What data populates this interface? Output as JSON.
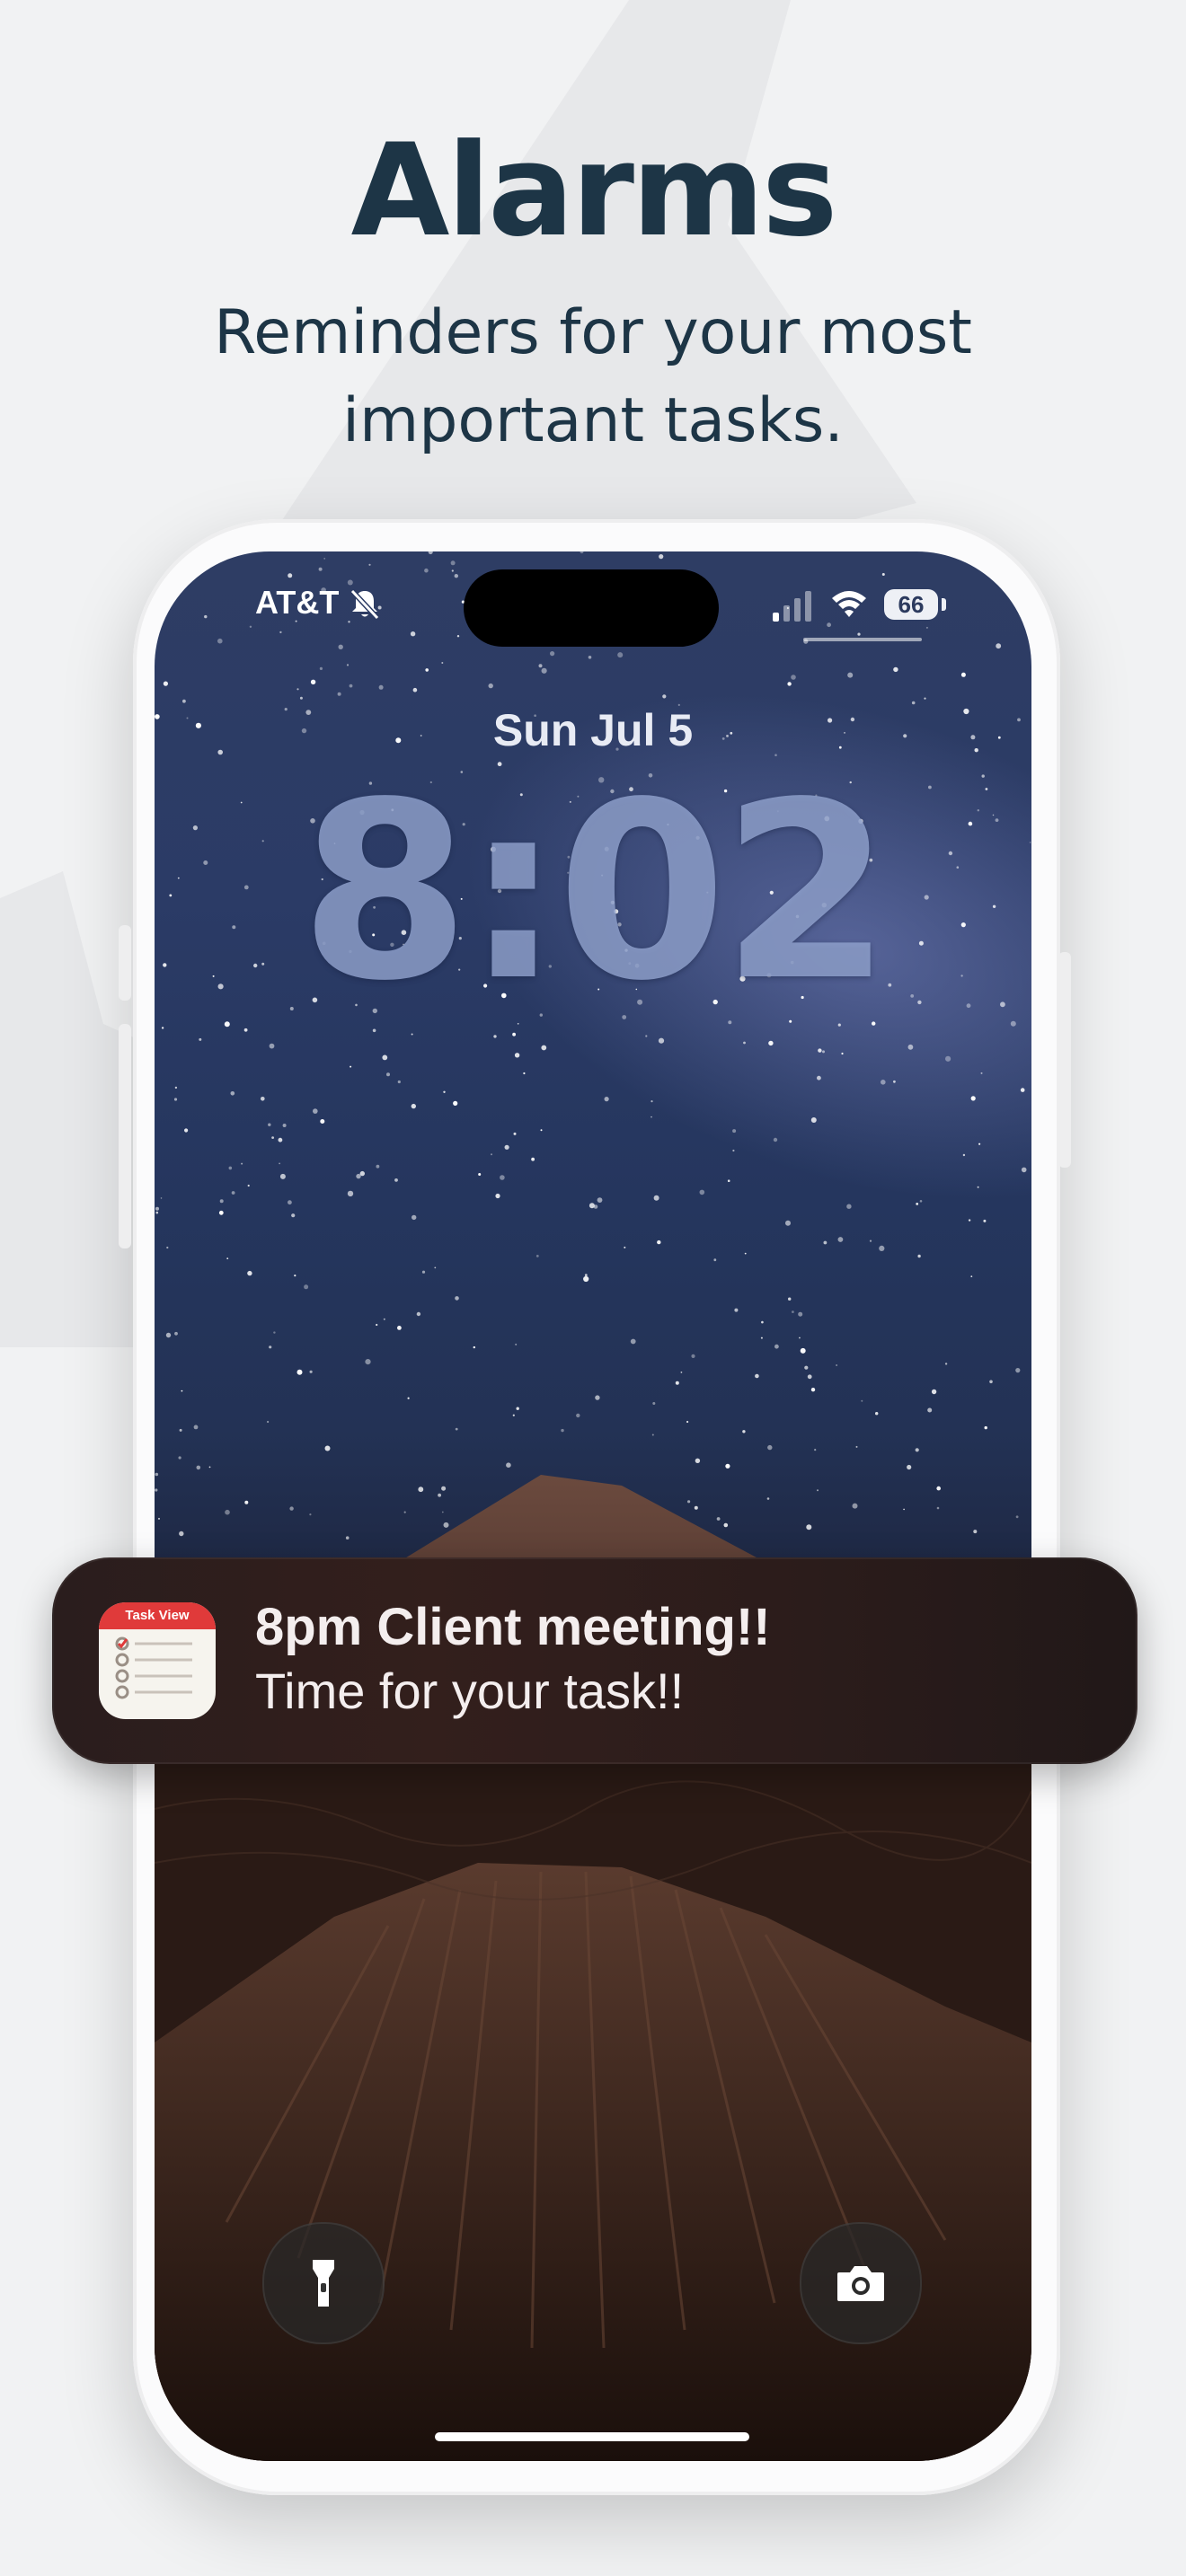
{
  "header": {
    "title": "Alarms",
    "subtitle_line1": "Reminders for your most",
    "subtitle_line2": "important tasks."
  },
  "status_bar": {
    "carrier": "AT&T",
    "battery": "66",
    "silent_icon": "bell-slash-icon",
    "signal_icon": "cellular-signal-icon",
    "wifi_icon": "wifi-icon"
  },
  "lock_screen": {
    "date": "Sun Jul 5",
    "time": "8:02"
  },
  "notification": {
    "app_icon_label": "Task View",
    "title": "8pm Client meeting!!",
    "body": "Time for your task!!"
  },
  "quick_actions": {
    "left_icon": "flashlight-icon",
    "right_icon": "camera-icon"
  },
  "colors": {
    "headline": "#1d3546",
    "background": "#f1f2f3",
    "notification_bg": "#2e1e1c",
    "app_icon_red": "#e03a3a"
  }
}
